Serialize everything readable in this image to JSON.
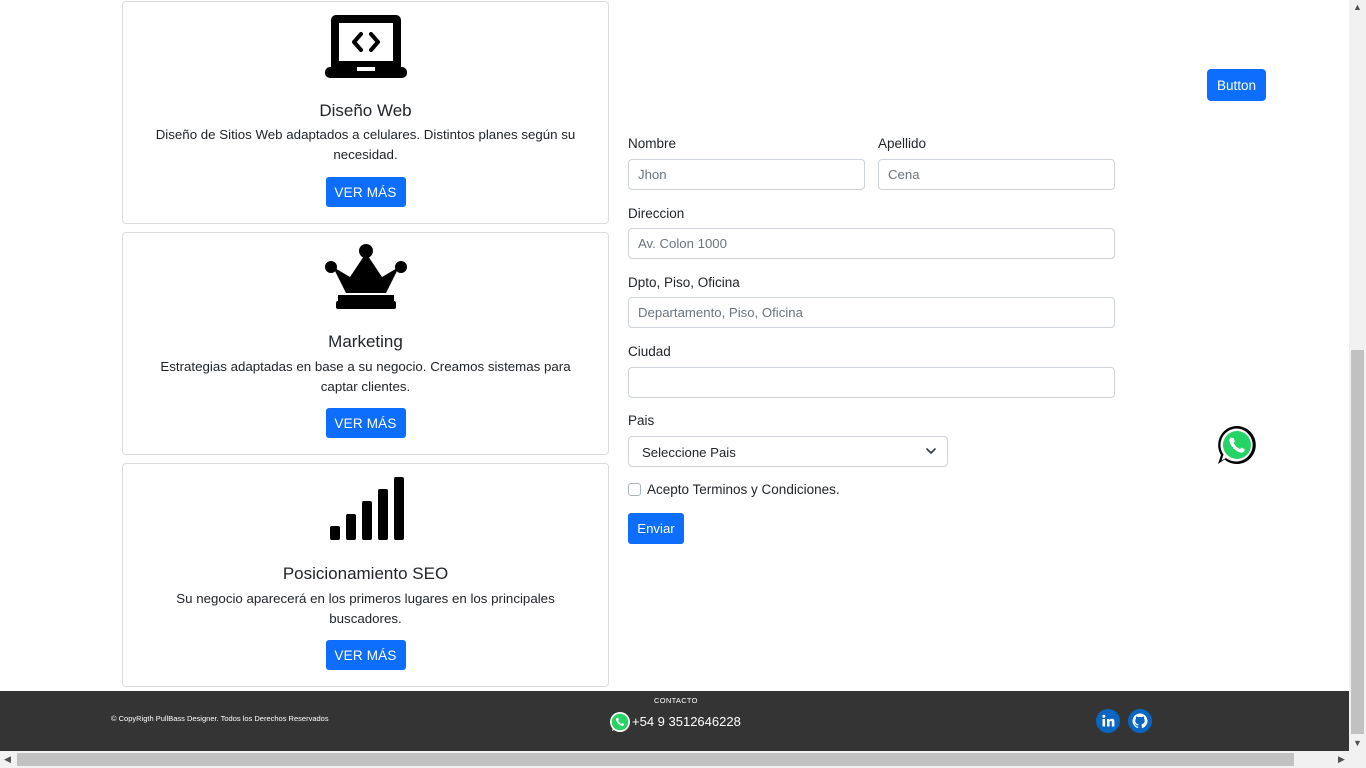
{
  "services": [
    {
      "title": "Diseño Web",
      "description": "Diseño de Sitios Web adaptados a celulares. Distintos planes según su necesidad.",
      "button": "VER MÁS",
      "icon": "laptop-code-icon"
    },
    {
      "title": "Marketing",
      "description": "Estrategias adaptadas en base a su negocio. Creamos sistemas para captar clientes.",
      "button": "VER MÁS",
      "icon": "crown-icon"
    },
    {
      "title": "Posicionamiento SEO",
      "description": "Su negocio aparecerá en los primeros lugares en los principales buscadores.",
      "button": "VER MÁS",
      "icon": "signal-bars-icon"
    }
  ],
  "top_button": "Button",
  "form": {
    "nombre": {
      "label": "Nombre",
      "placeholder": "Jhon"
    },
    "apellido": {
      "label": "Apellido",
      "placeholder": "Cena"
    },
    "direccion": {
      "label": "Direccion",
      "placeholder": "Av. Colon 1000"
    },
    "dpto": {
      "label": "Dpto, Piso, Oficina",
      "placeholder": "Departamento, Piso, Oficina"
    },
    "ciudad": {
      "label": "Ciudad",
      "placeholder": ""
    },
    "pais": {
      "label": "Pais",
      "selected": "Seleccione Pais"
    },
    "terms_label": "Acepto Terminos y Condiciones.",
    "submit": "Enviar"
  },
  "footer": {
    "copyright": "© CopyRigth PullBass Designer. Todos los Derechos Reservados",
    "contact_title": "CONTACTO",
    "phone": "+54 9 3512646228",
    "social": [
      "linkedin-icon",
      "github-icon"
    ]
  },
  "colors": {
    "primary": "#0d6efd",
    "footer_bg": "#343434",
    "whatsapp": "#25d366",
    "linkedin": "#0a66c2"
  }
}
